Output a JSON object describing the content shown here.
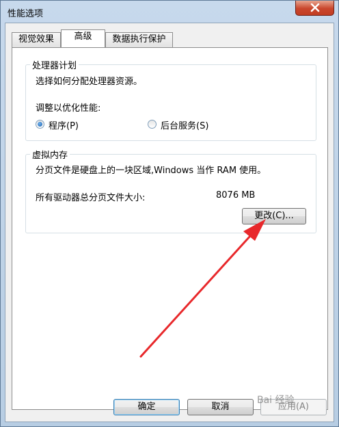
{
  "window": {
    "title": "性能选项"
  },
  "tabs": [
    {
      "label": "视觉效果"
    },
    {
      "label": "高级"
    },
    {
      "label": "数据执行保护"
    }
  ],
  "processor": {
    "group_title": "处理器计划",
    "description": "选择如何分配处理器资源。",
    "adjust_label": "调整以优化性能:",
    "options": [
      {
        "label": "程序(P)",
        "selected": true
      },
      {
        "label": "后台服务(S)",
        "selected": false
      }
    ]
  },
  "virtual_memory": {
    "group_title": "虚拟内存",
    "description": "分页文件是硬盘上的一块区域,Windows 当作 RAM 使用。",
    "total_label": "所有驱动器总分页文件大小:",
    "total_value": "8076 MB",
    "change_button": "更改(C)..."
  },
  "footer": {
    "ok": "确定",
    "cancel": "取消",
    "apply": "应用(A)"
  },
  "watermark": "Bai 经验",
  "colors": {
    "annotation_arrow": "#e8282b",
    "close_button": "#c9462c"
  }
}
